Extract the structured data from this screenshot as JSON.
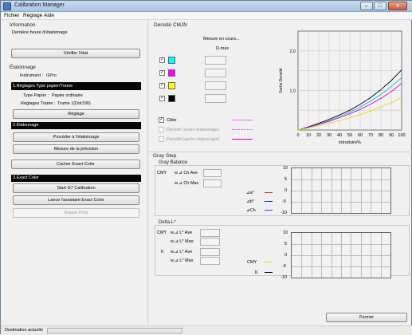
{
  "window": {
    "title": "Calibration Manager",
    "min": "–",
    "max": "□",
    "close": "x"
  },
  "menu": [
    "Fichier",
    "Réglage",
    "Aide"
  ],
  "left": {
    "information_title": "Information",
    "last_calibration_label": "Dernière heure d'étalonnage",
    "verify_button": "Vérifier l'état",
    "etalonnage_title": "Étalonnage",
    "instrument_label": "Instrument :",
    "instrument_value": "i1Pro",
    "section1_title": "1.Réglages Type papier/Trame",
    "paper_type_label": "Type Papier :",
    "paper_type_value": "Papier ordinaire",
    "screen_label": "Réglages Trame :",
    "screen_value": "Trame 1(Dot190)",
    "setting_button": "Réglage",
    "section2_title": "2.Étalonnage",
    "proceed_button": "Procéder à l'étalonnage",
    "measure_button": "Mesure de la précision",
    "hide_exact_button": "Cacher Exact Color",
    "section3_title": "3.Exact Color",
    "g7_button": "Start G7 Calibration",
    "assistant_button": "Lance l'assistant Exact Color",
    "report_button": "Report Print"
  },
  "density": {
    "title": "Densité CMJN",
    "measuring_label": "Mesure en cours...",
    "dmax_label": "D-max",
    "channels": [
      {
        "name": "cyan",
        "color": "#00ffff",
        "checked": "✓",
        "dmax": ""
      },
      {
        "name": "magenta",
        "color": "#ff00ff",
        "checked": "✓",
        "dmax": ""
      },
      {
        "name": "yellow",
        "color": "#ffff00",
        "checked": "✓",
        "dmax": ""
      },
      {
        "name": "black",
        "color": "#000000",
        "checked": "✓",
        "dmax": ""
      }
    ],
    "target_check": "✓",
    "target_label": "Cible",
    "before_label": "Densité (avant étalonnage)",
    "after_label": "Densité (après étalonnage)"
  },
  "chart_data": {
    "type": "line",
    "xlabel": "introduire%",
    "ylabel": "Sortie Densité",
    "x_ticks": [
      "0",
      "10",
      "20",
      "30",
      "40",
      "50",
      "60",
      "70",
      "80",
      "90",
      "100"
    ],
    "y_ticks": [
      "2.0",
      "1.0"
    ],
    "xlim": [
      0,
      100
    ],
    "ylim": [
      0,
      2.5
    ],
    "grid": true,
    "x": [
      0,
      10,
      20,
      30,
      40,
      50,
      60,
      70,
      80,
      90,
      100
    ],
    "series": [
      {
        "color": "#000000",
        "values": [
          0,
          0.08,
          0.17,
          0.27,
          0.38,
          0.5,
          0.65,
          0.82,
          1.02,
          1.25,
          1.52
        ]
      },
      {
        "color": "#00c8c8",
        "values": [
          0,
          0.07,
          0.15,
          0.24,
          0.34,
          0.45,
          0.58,
          0.73,
          0.9,
          1.1,
          1.32
        ]
      },
      {
        "color": "#e000e0",
        "values": [
          0,
          0.07,
          0.14,
          0.22,
          0.31,
          0.41,
          0.52,
          0.65,
          0.8,
          0.97,
          1.18
        ]
      },
      {
        "color": "#e0e000",
        "values": [
          0,
          0.05,
          0.11,
          0.17,
          0.24,
          0.31,
          0.39,
          0.48,
          0.58,
          0.69,
          0.82
        ]
      }
    ]
  },
  "gray": {
    "title": "Gray Step",
    "balance_title": "Gray Balance",
    "cmy_label": "CMY",
    "ch_ave_label": "w.⊿ Ch Ave",
    "ch_max_label": "w.⊿ Ch Max",
    "legend": [
      {
        "label": "⊿a*",
        "color": "#e02020"
      },
      {
        "label": "⊿b*",
        "color": "#2020d0"
      },
      {
        "label": "⊿Ch",
        "color": "#8020c0"
      }
    ],
    "ticks_top": [
      "10",
      "5",
      "0",
      "-5",
      "-10"
    ],
    "delta_title": "Delta-L*",
    "k_label": "K",
    "l_ave_label": "w.⊿ L* Ave",
    "l_max_label": "w.⊿ L* Max",
    "legend2": [
      {
        "label": "CMY",
        "color": "#e0e000"
      },
      {
        "label": "K",
        "color": "#000000"
      }
    ],
    "ticks_bottom": [
      "10",
      "5",
      "0",
      "-5",
      "-10"
    ]
  },
  "close_button": "Fermer",
  "status": {
    "label": "Destination actuelle"
  }
}
